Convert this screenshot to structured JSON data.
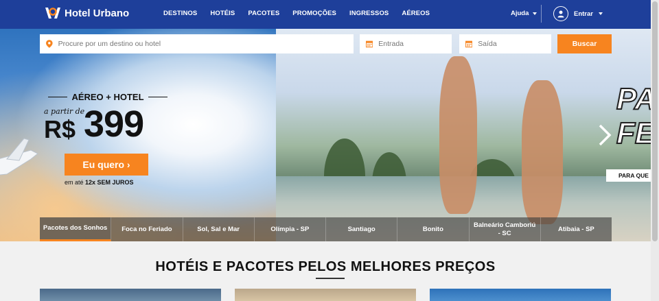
{
  "header": {
    "logo_text": "Hotel Urbano",
    "nav": [
      "DESTINOS",
      "HOTÉIS",
      "PACOTES",
      "PROMOÇÕES",
      "INGRESSOS",
      "AÉREOS"
    ],
    "help_label": "Ajuda",
    "login_label": "Entrar"
  },
  "search": {
    "destination_placeholder": "Procure por um destino ou hotel",
    "checkin_placeholder": "Entrada",
    "checkout_placeholder": "Saída",
    "button_label": "Buscar"
  },
  "promo": {
    "title": "AÉREO + HOTEL",
    "prefix": "a partir de",
    "currency": "R$",
    "price": "399",
    "cta_label": "Eu quero ›",
    "installments_prefix": "em até",
    "installments_bold": "12x SEM JUROS"
  },
  "banner_right": {
    "big_text_line1": "PA",
    "big_text_line2": "FE",
    "tag": "PARA QUE"
  },
  "categories": [
    "Pacotes dos Sonhos",
    "Foca no Feriado",
    "Sol, Sal e Mar",
    "Olímpia - SP",
    "Santiago",
    "Bonito",
    "Balneário Camboriú - SC",
    "Atibaia - SP"
  ],
  "section": {
    "title": "HOTÉIS E PACOTES PELOS MELHORES PREÇOS"
  },
  "colors": {
    "header_blue": "#1e3f9a",
    "accent_orange": "#f7841f"
  }
}
